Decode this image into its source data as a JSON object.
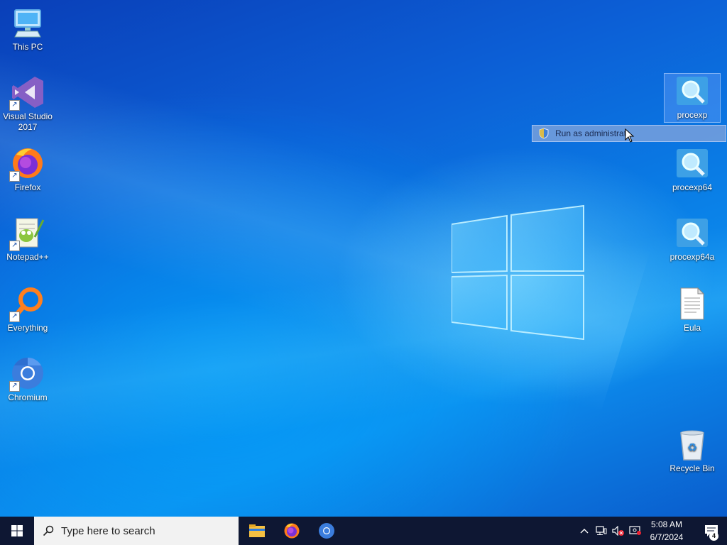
{
  "desktop_left": [
    {
      "label": "This PC",
      "icon": "computer-icon",
      "shortcut": false
    },
    {
      "label": "Visual Studio 2017",
      "icon": "visual-studio-icon",
      "shortcut": true
    },
    {
      "label": "Firefox",
      "icon": "firefox-icon",
      "shortcut": true
    },
    {
      "label": "Notepad++",
      "icon": "notepad-plus-plus-icon",
      "shortcut": true
    },
    {
      "label": "Everything",
      "icon": "everything-search-icon",
      "shortcut": true
    },
    {
      "label": "Chromium",
      "icon": "chromium-icon",
      "shortcut": true
    }
  ],
  "desktop_right": [
    {
      "label": "procexp",
      "icon": "procexp-icon",
      "selected": true
    },
    {
      "label": "procexp64",
      "icon": "procexp-icon"
    },
    {
      "label": "procexp64a",
      "icon": "procexp-icon"
    },
    {
      "label": "Eula",
      "icon": "document-icon"
    },
    {
      "label": "Recycle Bin",
      "icon": "recycle-bin-icon"
    }
  ],
  "context_menu": {
    "items": [
      {
        "label": "Run as administrat",
        "icon": "uac-shield-icon"
      }
    ]
  },
  "taskbar": {
    "search_placeholder": "Type here to search",
    "pinned": [
      {
        "name": "file-explorer",
        "icon": "folder-icon"
      },
      {
        "name": "firefox",
        "icon": "firefox-icon"
      },
      {
        "name": "chromium",
        "icon": "chromium-icon"
      }
    ],
    "clock": {
      "time": "5:08 AM",
      "date": "6/7/2024"
    },
    "notification_count": "4"
  },
  "colors": {
    "taskbar_bg": "#0e1733",
    "desktop_accent": "#0a7ee6",
    "selection": "#78aaff"
  }
}
